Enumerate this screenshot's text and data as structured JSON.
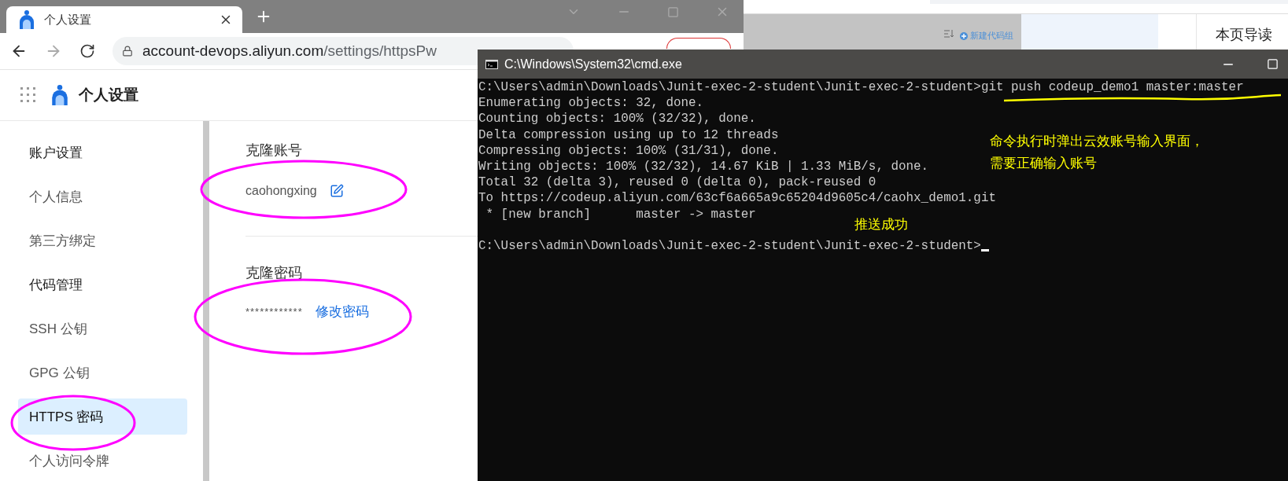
{
  "browser": {
    "tab": {
      "title": "个人设置",
      "selected": true
    },
    "url": {
      "host": "account-devops.aliyun.com",
      "path": "/settings/httpsPw"
    },
    "header": {
      "title": "个人设置"
    },
    "sidebar": {
      "items": [
        {
          "label": "账户设置",
          "kind": "group",
          "selected": false
        },
        {
          "label": "个人信息",
          "kind": "item",
          "selected": false
        },
        {
          "label": "第三方绑定",
          "kind": "item",
          "selected": false
        },
        {
          "label": "代码管理",
          "kind": "group",
          "selected": false
        },
        {
          "label": "SSH 公钥",
          "kind": "item",
          "selected": false
        },
        {
          "label": "GPG 公钥",
          "kind": "item",
          "selected": false
        },
        {
          "label": "HTTPS 密码",
          "kind": "item",
          "selected": true
        },
        {
          "label": "个人访问令牌",
          "kind": "item",
          "selected": false
        }
      ]
    },
    "clone_account": {
      "title": "克隆账号",
      "value": "caohongxing"
    },
    "clone_password": {
      "title": "克隆密码",
      "value": "************",
      "link": "修改密码"
    }
  },
  "background_page": {
    "new_group": "新建代码组",
    "toc_title": "本页导读"
  },
  "cmd": {
    "title": "C:\\Windows\\System32\\cmd.exe",
    "lines": [
      {
        "kind": "prompt",
        "prompt": "C:\\Users\\admin\\Downloads\\Junit-exec-2-student\\Junit-exec-2-student>",
        "command": "git push codeup_demo1 master:master"
      },
      {
        "kind": "output",
        "text": "Enumerating objects: 32, done."
      },
      {
        "kind": "output",
        "text": "Counting objects: 100% (32/32), done."
      },
      {
        "kind": "output",
        "text": "Delta compression using up to 12 threads"
      },
      {
        "kind": "output",
        "text": "Compressing objects: 100% (31/31), done."
      },
      {
        "kind": "output",
        "text": "Writing objects: 100% (32/32), 14.67 KiB | 1.33 MiB/s, done."
      },
      {
        "kind": "output",
        "text": "Total 32 (delta 3), reused 0 (delta 0), pack-reused 0"
      },
      {
        "kind": "output",
        "text": "To https://codeup.aliyun.com/63cf6a665a9c65204d9605c4/caohx_demo1.git"
      },
      {
        "kind": "output",
        "text": " * [new branch]      master -> master"
      },
      {
        "kind": "prompt",
        "prompt": "C:\\Users\\admin\\Downloads\\Junit-exec-2-student\\Junit-exec-2-student>",
        "space_before": true
      }
    ]
  },
  "annotations": {
    "notes": [
      "命令执行时弹出云效账号输入界面，",
      "需要正确输入账号",
      "推送成功"
    ]
  }
}
